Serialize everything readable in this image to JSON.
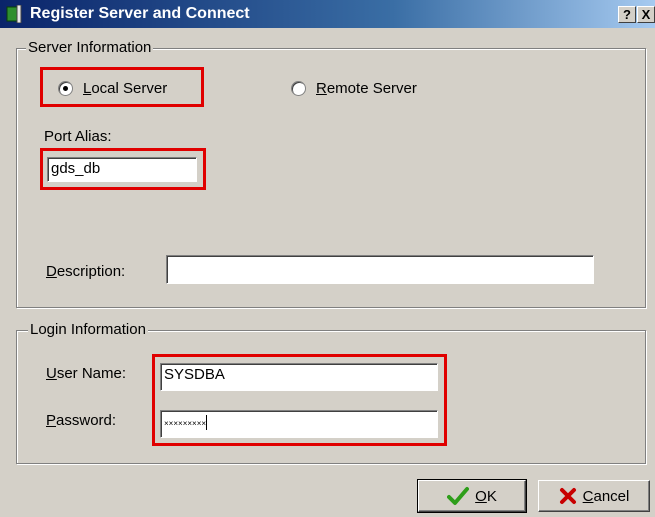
{
  "window": {
    "title": "Register Server and Connect",
    "help_glyph": "?",
    "close_glyph": "X"
  },
  "server_info": {
    "legend": "Server Information",
    "local_server": {
      "access_key": "L",
      "rest": "ocal Server",
      "selected": true
    },
    "remote_server": {
      "access_key": "R",
      "rest": "emote Server",
      "selected": false
    },
    "port_alias_label": "Port Alias:",
    "port_alias_value": "gds_db",
    "description": {
      "access_key": "D",
      "rest": "escription:",
      "value": ""
    }
  },
  "login_info": {
    "legend": "Login Information",
    "user_name": {
      "access_key": "U",
      "rest": "ser Name:",
      "value": "SYSDBA"
    },
    "password": {
      "access_key": "P",
      "rest": "assword:",
      "value": "×××××××××"
    }
  },
  "buttons": {
    "ok": {
      "access_key": "O",
      "rest": "K",
      "icon": "checkmark-icon",
      "icon_color": "#2e9e1a"
    },
    "cancel": {
      "access_key": "C",
      "rest": "ancel",
      "icon": "x-mark-icon",
      "icon_color": "#c80000"
    }
  },
  "highlight_color": "#e00000"
}
